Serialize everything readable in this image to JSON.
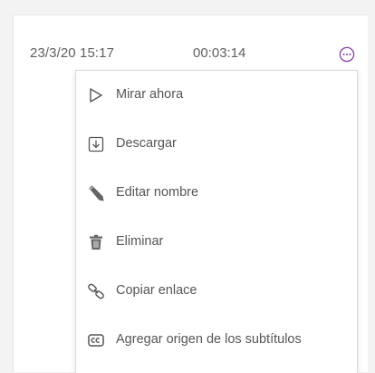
{
  "recording": {
    "date": "23/3/20 15:17",
    "duration": "00:03:14",
    "more_icon": "more-options-icon",
    "accent_color": "#8b3fa8"
  },
  "menu": {
    "items": [
      {
        "label": "Mirar ahora",
        "icon": "play-icon"
      },
      {
        "label": "Descargar",
        "icon": "download-icon"
      },
      {
        "label": "Editar nombre",
        "icon": "pencil-icon"
      },
      {
        "label": "Eliminar",
        "icon": "trash-icon"
      },
      {
        "label": "Copiar enlace",
        "icon": "link-icon"
      },
      {
        "label": "Agregar origen de los subtítulos",
        "icon": "closed-captions-icon"
      }
    ]
  }
}
